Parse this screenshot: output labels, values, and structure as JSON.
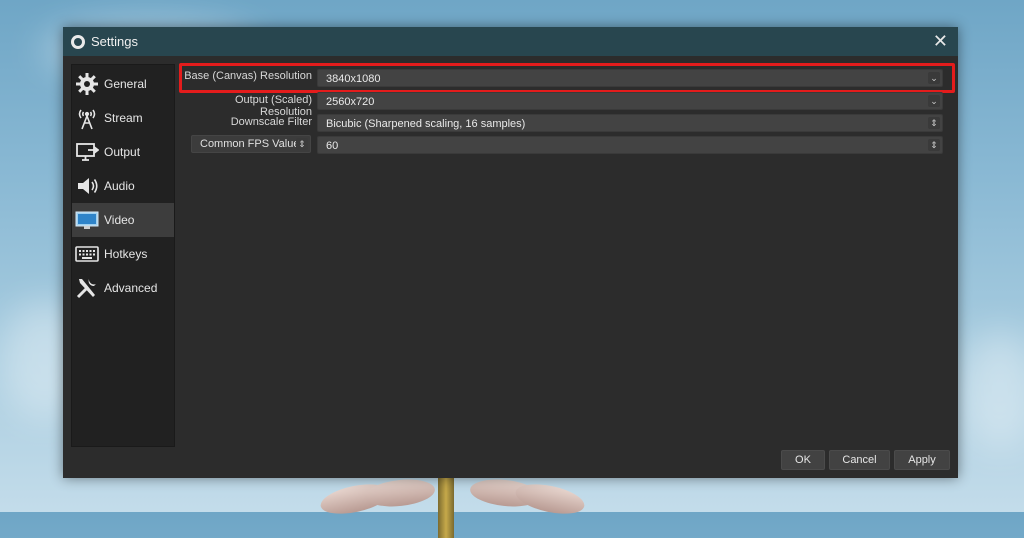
{
  "window": {
    "title": "Settings",
    "close_glyph": "✕"
  },
  "sidebar": {
    "items": [
      {
        "label": "General",
        "icon": "gear-icon"
      },
      {
        "label": "Stream",
        "icon": "antenna-icon"
      },
      {
        "label": "Output",
        "icon": "output-icon"
      },
      {
        "label": "Audio",
        "icon": "speaker-icon"
      },
      {
        "label": "Video",
        "icon": "monitor-icon",
        "active": true
      },
      {
        "label": "Hotkeys",
        "icon": "keyboard-icon"
      },
      {
        "label": "Advanced",
        "icon": "tools-icon"
      }
    ]
  },
  "video": {
    "base_label": "Base (Canvas) Resolution",
    "base_value": "3840x1080",
    "output_label": "Output (Scaled) Resolution",
    "output_value": "2560x720",
    "filter_label": "Downscale Filter",
    "filter_value": "Bicubic (Sharpened scaling, 16 samples)",
    "fps_label": "Common FPS Values",
    "fps_value": "60"
  },
  "buttons": {
    "ok": "OK",
    "cancel": "Cancel",
    "apply": "Apply"
  },
  "colors": {
    "titlebar": "#28464f",
    "highlight": "#e41c1c",
    "panel": "#2c2c2c"
  }
}
